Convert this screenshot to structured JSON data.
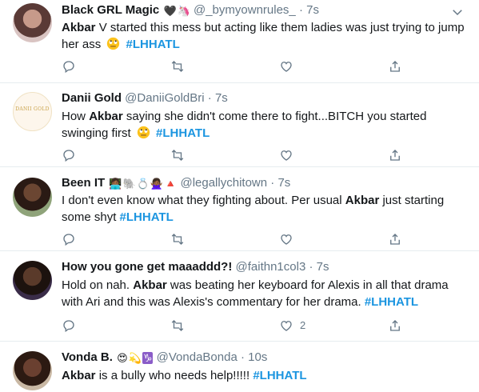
{
  "tweets": [
    {
      "name": "Black GRL Magic",
      "badges": [
        "black-heart",
        "unicorn"
      ],
      "handle": "@_bymyownrules_",
      "time": "7s",
      "segments": [
        {
          "t": "Akbar",
          "s": "bold"
        },
        {
          "t": " V started this mess but acting like them ladies was just trying to jump her ass ",
          "s": "text"
        },
        {
          "t": "🙄",
          "s": "roll"
        },
        {
          "t": " #LHHATL",
          "s": "tag"
        }
      ],
      "like_count": ""
    },
    {
      "name": "Danii Gold",
      "badges": [],
      "handle": "@DaniiGoldBri",
      "time": "7s",
      "avatar_text": "DANII GOLD",
      "segments": [
        {
          "t": "How ",
          "s": "text"
        },
        {
          "t": "Akbar",
          "s": "bold"
        },
        {
          "t": " saying she didn't come there to fight...BITCH you started swinging first ",
          "s": "text"
        },
        {
          "t": "🙄",
          "s": "roll"
        },
        {
          "t": " #LHHATL",
          "s": "tag"
        }
      ],
      "like_count": ""
    },
    {
      "name": "Been IT",
      "badges": [
        "woman-technologist",
        "elephant",
        "ring",
        "woman-gesturing",
        "red-triangle"
      ],
      "handle": "@legallychitown",
      "time": "7s",
      "segments": [
        {
          "t": "I don't even know what they fighting about. Per usual ",
          "s": "text"
        },
        {
          "t": "Akbar",
          "s": "bold"
        },
        {
          "t": " just starting some shyt ",
          "s": "text"
        },
        {
          "t": " #LHHATL",
          "s": "tag"
        }
      ],
      "like_count": ""
    },
    {
      "name": "How you gone get maaaddd?!",
      "badges": [],
      "handle": "@faithn1col3",
      "time": "7s",
      "segments": [
        {
          "t": "Hold on nah. ",
          "s": "text"
        },
        {
          "t": "Akbar",
          "s": "bold"
        },
        {
          "t": " was beating her keyboard for Alexis in all that drama with Ari and this was Alexis's commentary for her drama. ",
          "s": "text"
        },
        {
          "t": " #LHHATL",
          "s": "tag"
        }
      ],
      "like_count": "2"
    },
    {
      "name": "Vonda B.",
      "badges": [
        "heart-eyes",
        "dizzy",
        "capricorn"
      ],
      "handle": "@VondaBonda",
      "time": "10s",
      "segments": [
        {
          "t": "Akbar",
          "s": "bold"
        },
        {
          "t": " is a bully who needs help!!!!! ",
          "s": "text"
        },
        {
          "t": "#LHHATL",
          "s": "tag"
        }
      ],
      "like_count": ""
    }
  ],
  "badge_glyphs": {
    "black-heart": "🖤",
    "unicorn": "🦄",
    "woman-technologist": "👩🏾‍💻",
    "elephant": "🐘",
    "ring": "💍",
    "woman-gesturing": "🙅🏾‍♀️",
    "red-triangle": "🔺",
    "heart-eyes": "😍",
    "dizzy": "💫",
    "capricorn": "♑"
  },
  "icons": [
    "chevron-down-icon",
    "reply-icon",
    "retweet-icon",
    "like-icon",
    "share-icon"
  ],
  "colors": {
    "link": "#1b95e0",
    "secondary": "#657786",
    "divider": "#e6ecf0"
  }
}
